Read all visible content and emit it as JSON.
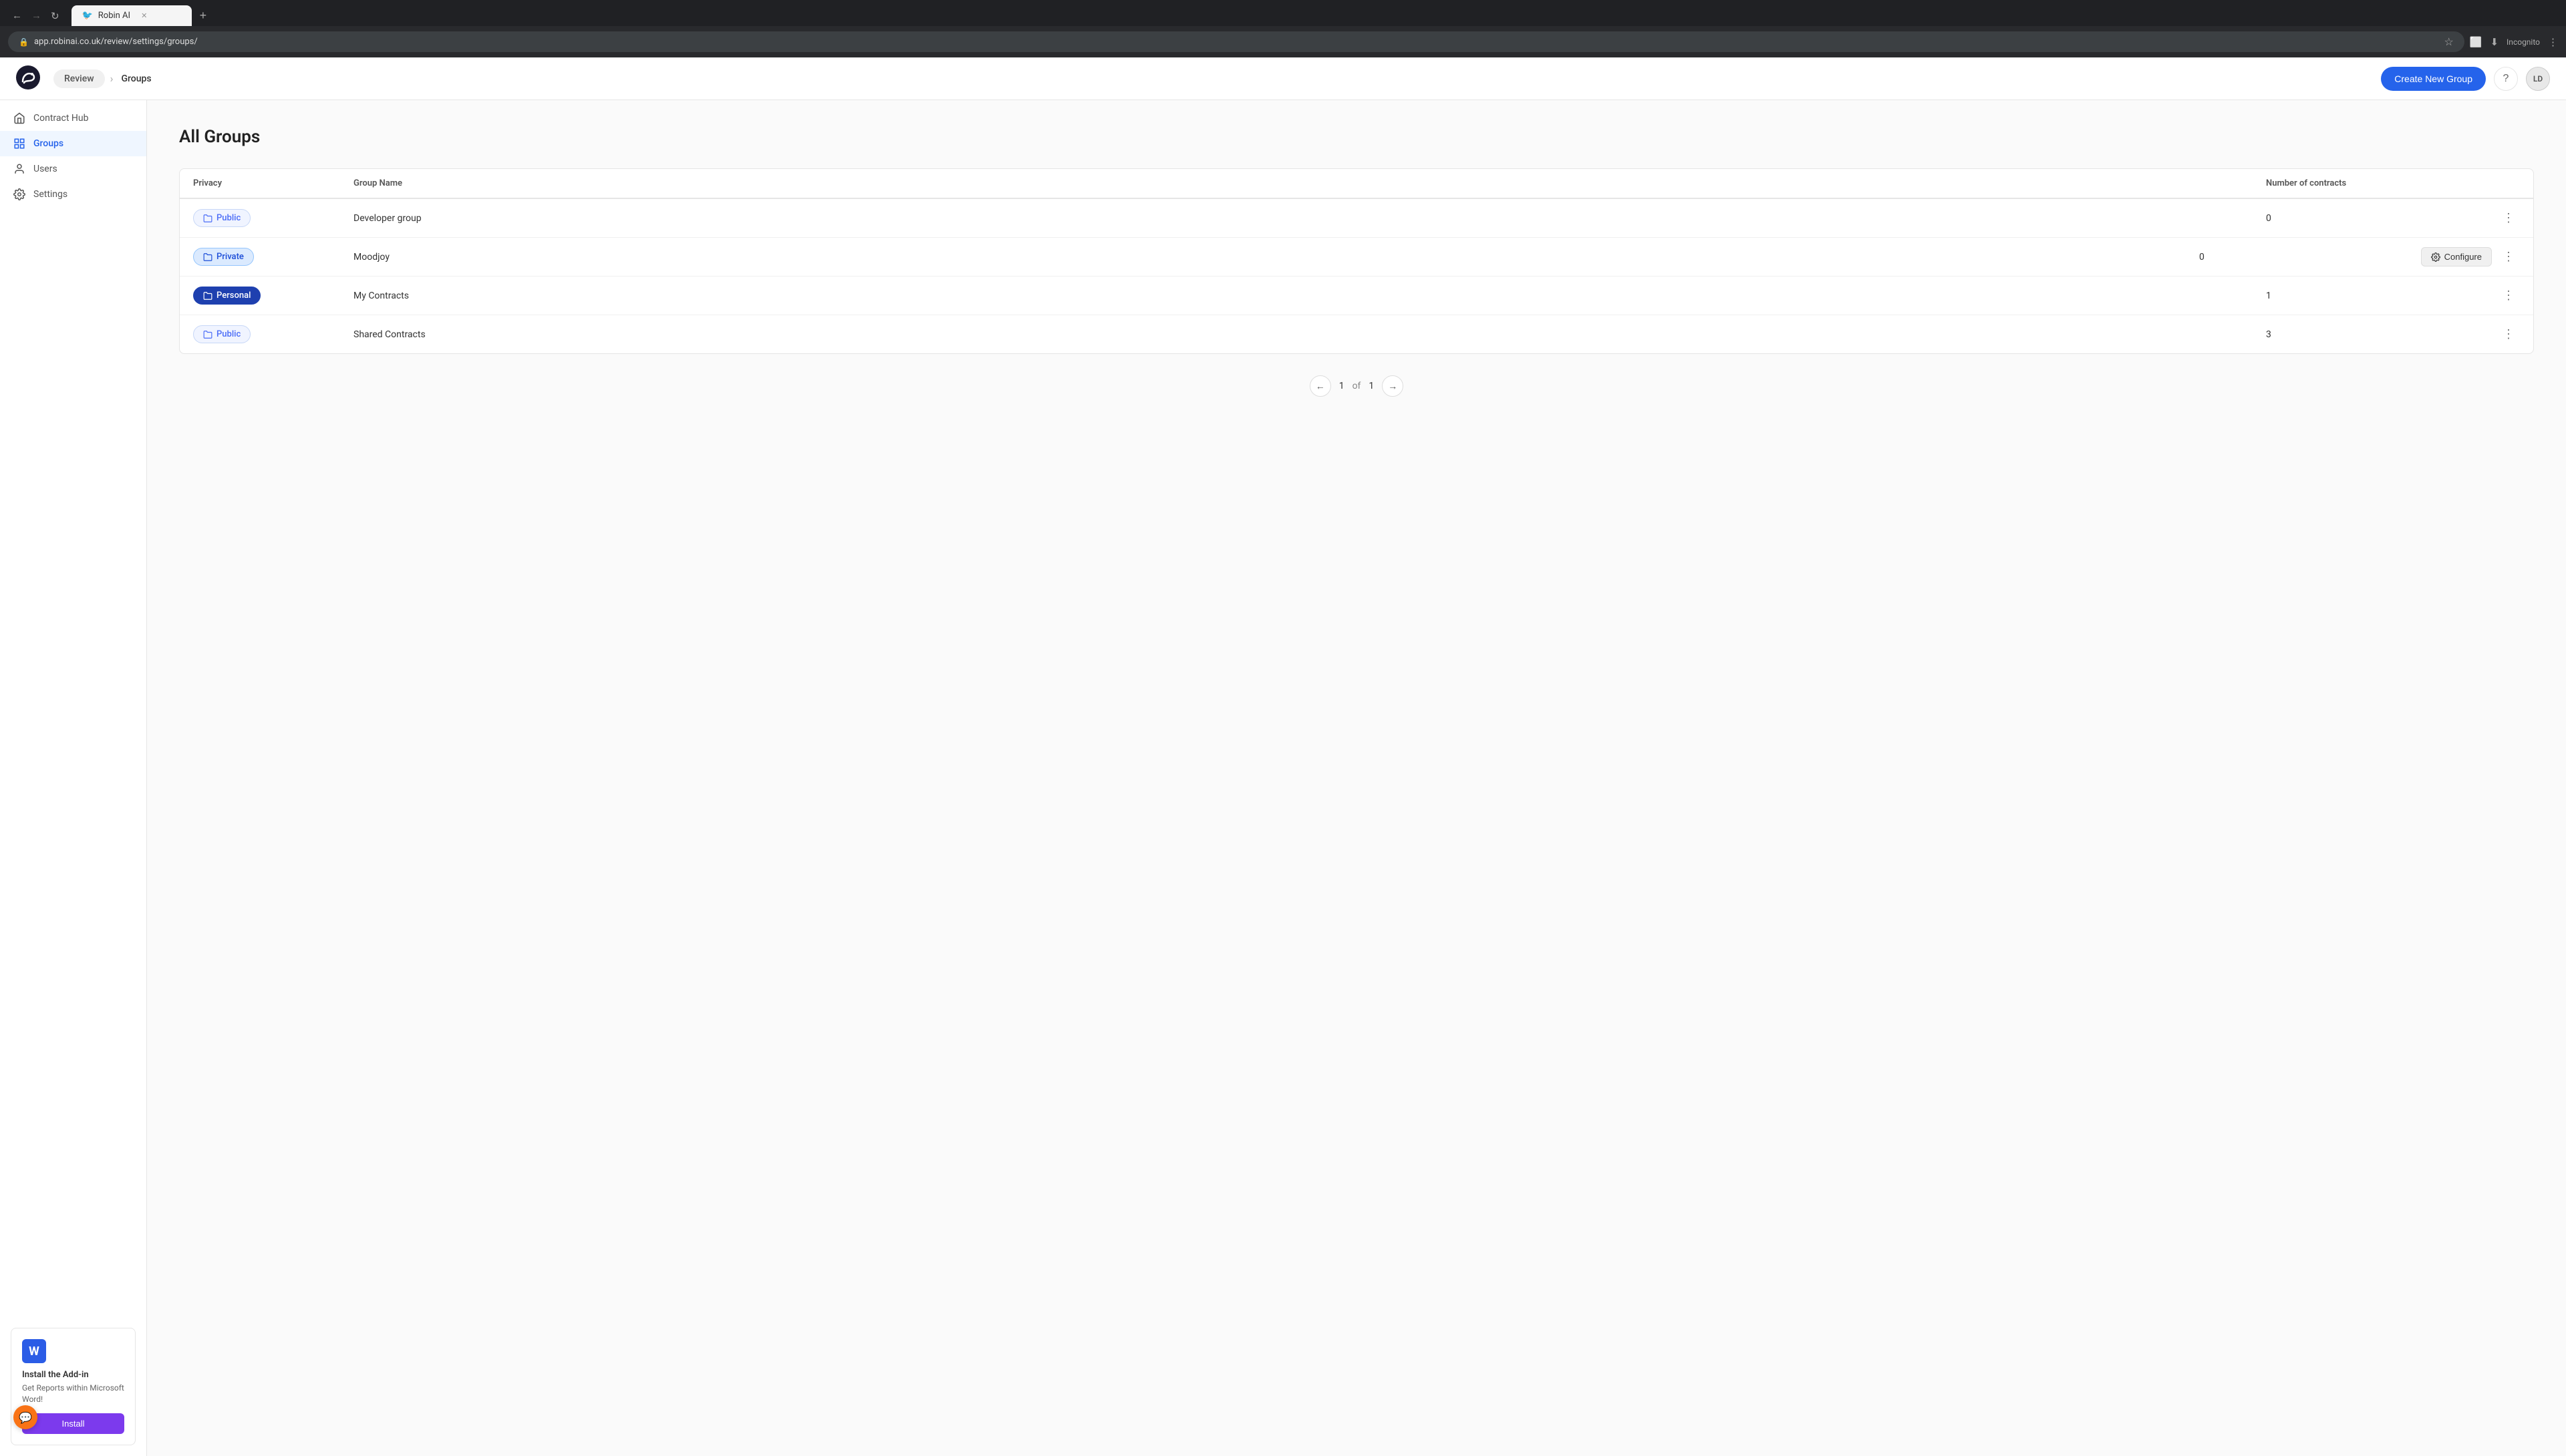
{
  "browser": {
    "tab_label": "Robin AI",
    "tab_icon": "🐦",
    "address": "app.robinai.co.uk/review/settings/groups/",
    "incognito_label": "Incognito"
  },
  "header": {
    "nav_review": "Review",
    "nav_groups": "Groups",
    "create_btn_label": "Create New Group",
    "help_icon": "?",
    "avatar_label": "LD"
  },
  "sidebar": {
    "items": [
      {
        "id": "contract-hub",
        "label": "Contract Hub",
        "active": false
      },
      {
        "id": "groups",
        "label": "Groups",
        "active": true
      },
      {
        "id": "users",
        "label": "Users",
        "active": false
      },
      {
        "id": "settings",
        "label": "Settings",
        "active": false
      }
    ],
    "addon": {
      "title": "Install the Add-in",
      "description": "Get Reports within Microsoft Word!",
      "button_label": "Install"
    }
  },
  "main": {
    "page_title": "All Groups",
    "table": {
      "columns": [
        "Privacy",
        "Group Name",
        "Number of contracts",
        ""
      ],
      "rows": [
        {
          "privacy": "Public",
          "privacy_type": "public",
          "group_name": "Developer group",
          "contracts": "0",
          "show_configure": false
        },
        {
          "privacy": "Private",
          "privacy_type": "private",
          "group_name": "Moodjoy",
          "contracts": "0",
          "show_configure": true
        },
        {
          "privacy": "Personal",
          "privacy_type": "personal",
          "group_name": "My Contracts",
          "contracts": "1",
          "show_configure": false
        },
        {
          "privacy": "Public",
          "privacy_type": "public",
          "group_name": "Shared Contracts",
          "contracts": "3",
          "show_configure": false
        }
      ]
    },
    "pagination": {
      "current_page": "1",
      "separator": "of",
      "total_pages": "1"
    }
  },
  "configure_label": "Configure"
}
